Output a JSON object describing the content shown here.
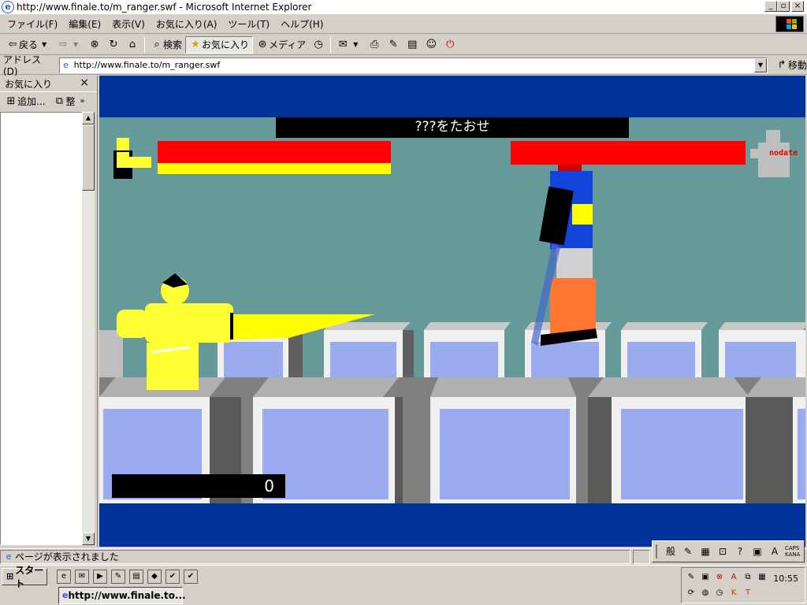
{
  "window": {
    "title": "http://www.finale.to/m_ranger.swf - Microsoft Internet Explorer",
    "icon": "ie-icon"
  },
  "menu": [
    "ファイル(F)",
    "編集(E)",
    "表示(V)",
    "お気に入り(A)",
    "ツール(T)",
    "ヘルプ(H)"
  ],
  "toolbar": {
    "back": "戻る",
    "search": "検索",
    "favorites": "お気に入り",
    "media": "メディア"
  },
  "address": {
    "label": "アドレス(D)",
    "url": "http://www.finale.to/m_ranger.swf",
    "go": "移動"
  },
  "favorites_pane": {
    "title": "お気に入り",
    "add": "追加...",
    "organize": "整"
  },
  "game": {
    "mission": "???をたおせ",
    "score": "0",
    "enemy_label": "nodate",
    "player_health": 1.0,
    "enemy_health": 1.0,
    "player_energy": 1.0,
    "colors": {
      "sky": "#669999",
      "frame": "#003399",
      "health": "#ff0000",
      "energy": "#ffff00",
      "player": "#ffff33"
    }
  },
  "status": {
    "text": "ページが表示されました"
  },
  "ime": {
    "mode": "般",
    "caps": "CAPS",
    "kana": "KANA"
  },
  "taskbar": {
    "start": "スタート",
    "task": "http://www.finale.to...",
    "clock": "10:55"
  }
}
